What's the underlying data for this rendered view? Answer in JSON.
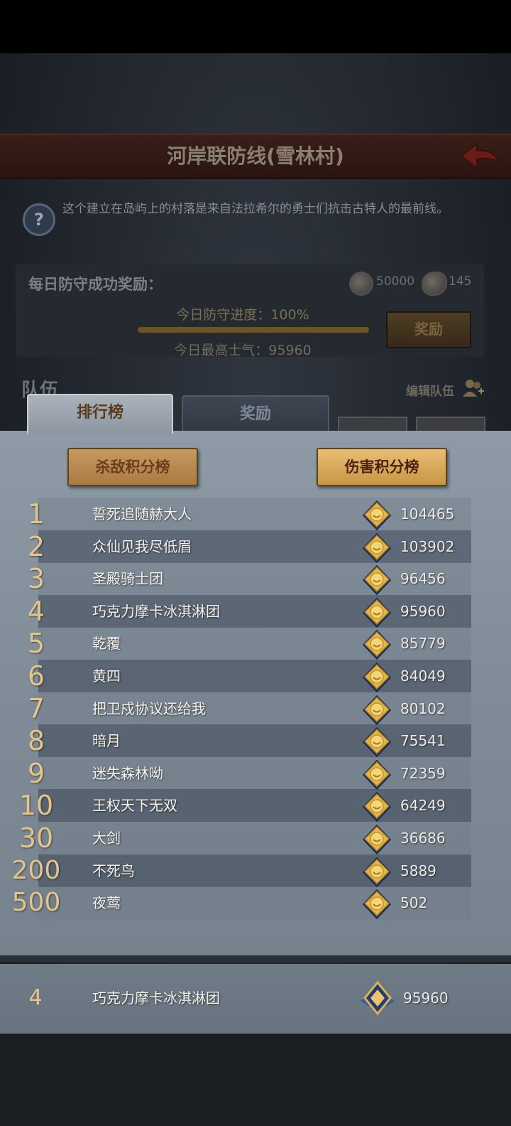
{
  "header": {
    "title": "河岸联防线(雪林村)"
  },
  "description": "这个建立在岛屿上的村落是来自法拉希尔的勇士们抗击古特人的最前线。",
  "daily_reward": {
    "label": "每日防守成功奖励：",
    "items": [
      {
        "icon": "silver-coin-icon",
        "amount": "50000"
      },
      {
        "icon": "gem-icon",
        "amount": "145"
      }
    ],
    "progress_text": "今日防守进度：100%",
    "progress": 1.0,
    "morale_text": "今日最高士气：95960",
    "reward_button": "奖励"
  },
  "team": {
    "label": "队伍",
    "edit_label": "编辑队伍"
  },
  "tabs": [
    {
      "label": "排行榜",
      "active": true
    },
    {
      "label": "奖励",
      "active": false
    }
  ],
  "board": {
    "kill_button": "杀敌积分榜",
    "damage_button": "伤害积分榜",
    "rows": [
      {
        "rank": "1",
        "name": "誓死追随赫大人",
        "score": "104465"
      },
      {
        "rank": "2",
        "name": "众仙见我尽低眉",
        "score": "103902"
      },
      {
        "rank": "3",
        "name": "圣殿骑士团",
        "score": "96456"
      },
      {
        "rank": "4",
        "name": "巧克力摩卡冰淇淋团",
        "score": "95960"
      },
      {
        "rank": "5",
        "name": "乾覆",
        "score": "85779"
      },
      {
        "rank": "6",
        "name": "黄四",
        "score": "84049"
      },
      {
        "rank": "7",
        "name": "把卫戍协议还给我",
        "score": "80102"
      },
      {
        "rank": "8",
        "name": "暗月",
        "score": "75541"
      },
      {
        "rank": "9",
        "name": "迷失森林呦",
        "score": "72359"
      },
      {
        "rank": "10",
        "name": "王权天下无双",
        "score": "64249"
      },
      {
        "rank": "30",
        "name": "大剑",
        "score": "36686"
      },
      {
        "rank": "200",
        "name": "不死鸟",
        "score": "5889"
      },
      {
        "rank": "500",
        "name": "夜莺",
        "score": "502"
      }
    ],
    "self": {
      "rank": "4",
      "name": "巧克力摩卡冰淇淋团",
      "score": "95960"
    }
  },
  "colors": {
    "rank_gold": "#e3c58a",
    "title_bar": "#3a1f1a",
    "board_bg": "#8e9aa6"
  }
}
